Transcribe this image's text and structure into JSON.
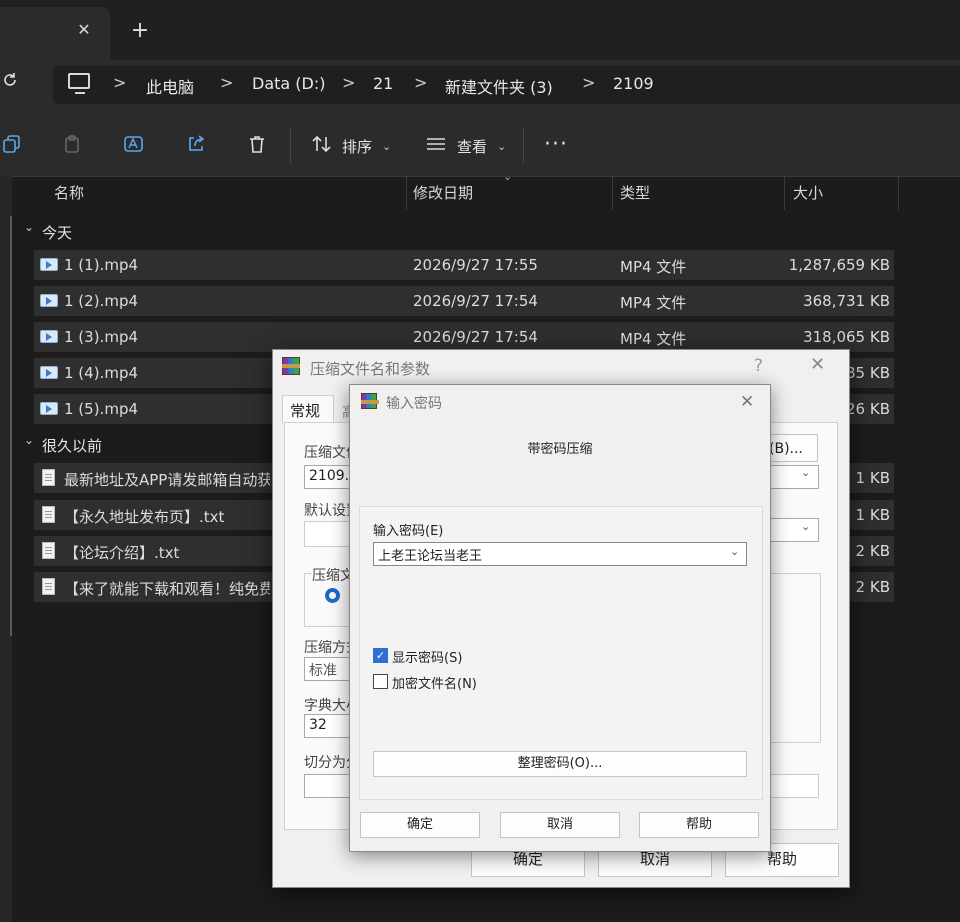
{
  "tabbar": {
    "close_glyph": "✕",
    "new_glyph": "+"
  },
  "address": {
    "crumbs": [
      "此电脑",
      "Data (D:)",
      "21",
      "新建文件夹 (3)",
      "2109"
    ],
    "separator": ">"
  },
  "toolbar": {
    "sort_label": "排序",
    "view_label": "查看",
    "more_label": "···"
  },
  "columns": {
    "name": "名称",
    "date": "修改日期",
    "type": "类型",
    "size": "大小"
  },
  "groups": {
    "today": "今天",
    "older": "很久以前"
  },
  "files": [
    {
      "name": "1 (1).mp4",
      "date": "2026/9/27 17:55",
      "type": "MP4 文件",
      "size": "1,287,659 KB"
    },
    {
      "name": "1 (2).mp4",
      "date": "2026/9/27 17:54",
      "type": "MP4 文件",
      "size": "368,731 KB"
    },
    {
      "name": "1 (3).mp4",
      "date": "2026/9/27 17:54",
      "type": "MP4 文件",
      "size": "318,065 KB"
    },
    {
      "name": "1 (4).mp4",
      "size": "85 KB"
    },
    {
      "name": "1 (5).mp4",
      "size": "26 KB"
    },
    {
      "name": "最新地址及APP请发邮箱自动获",
      "size": "1 KB"
    },
    {
      "name": "【永久地址发布页】.txt",
      "size": "1 KB"
    },
    {
      "name": "【论坛介绍】.txt",
      "size": "2 KB"
    },
    {
      "name": "【来了就能下载和观看！纯免费",
      "size": "2 KB"
    }
  ],
  "archive_dialog": {
    "title": "压缩文件名和参数",
    "help_glyph": "?",
    "close_glyph": "✕",
    "tab_general": "常规",
    "tab_partial": "高",
    "archive_name_label": "压缩文件",
    "archive_name_value": "2109.r",
    "browse_button": "(B)...",
    "default_label": "默认设置",
    "format_label": "压缩文",
    "method_label": "压缩方式",
    "method_value": "标准",
    "dict_label": "字典大小",
    "dict_value": "32",
    "split_label": "切分为分",
    "ok": "确定",
    "cancel": "取消",
    "help": "帮助"
  },
  "password_dialog": {
    "title": "输入密码",
    "close_glyph": "✕",
    "heading": "带密码压缩",
    "password_label": "输入密码(E)",
    "password_value": "上老王论坛当老王",
    "show_password": "显示密码(S)",
    "show_password_checked": true,
    "encrypt_names": "加密文件名(N)",
    "encrypt_names_checked": false,
    "organize_button": "整理密码(O)...",
    "ok": "确定",
    "cancel": "取消",
    "help": "帮助"
  }
}
